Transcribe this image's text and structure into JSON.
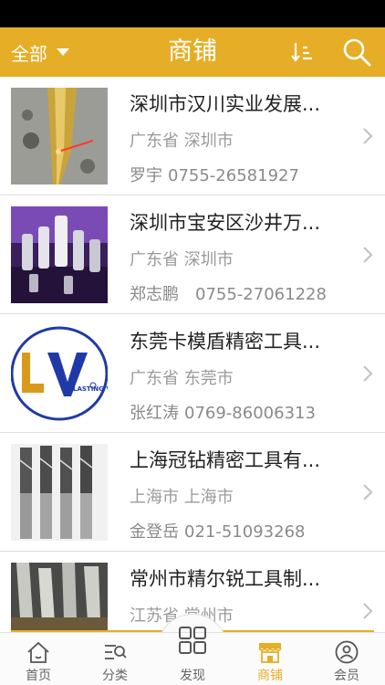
{
  "header": {
    "filter_label": "全部",
    "title": "商铺",
    "sort_icon": "sort-icon",
    "search_icon": "search-icon",
    "bar_color": "#e6ae26"
  },
  "shops": [
    {
      "name": "深圳市汉川实业发展...",
      "region": "广东省 深圳市",
      "person": "罗宇",
      "phone": "0755-26581927",
      "thumb": "gold-drill-bit"
    },
    {
      "name": "深圳市宝安区沙井万...",
      "region": "广东省 深圳市",
      "person": "郑志鹏",
      "phone": "0755-27061228",
      "thumb": "tool-holders-purple"
    },
    {
      "name": "东莞卡模盾精密工具...",
      "region": "广东省 东莞市",
      "person": "张红涛",
      "phone": "0769-86006313",
      "thumb": "lv-logo",
      "logo_text": "LASTING VICTORY"
    },
    {
      "name": "上海冠钻精密工具有...",
      "region": "上海市 上海市",
      "person": "金登岳",
      "phone": "021-51093268",
      "thumb": "end-mills"
    },
    {
      "name": "常州市精尔锐工具制...",
      "region": "江苏省 常州市",
      "person": "",
      "phone": "",
      "thumb": "cutting-tools"
    }
  ],
  "tabbar": {
    "home": "首页",
    "category": "分类",
    "discover": "发现",
    "shops": "商铺",
    "member": "会员",
    "active": "商铺"
  }
}
